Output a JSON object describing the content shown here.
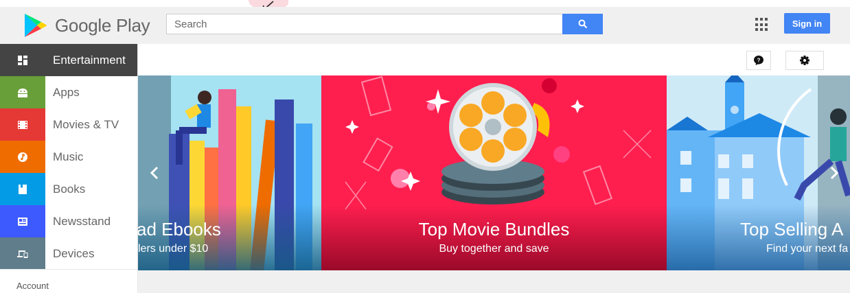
{
  "brand": {
    "name": "Google Play"
  },
  "search": {
    "placeholder": "Search"
  },
  "header": {
    "signin_label": "Sign in"
  },
  "sidebar": {
    "items": [
      {
        "label": "Entertainment",
        "color": "#444444",
        "icon": "entertainment-icon"
      },
      {
        "label": "Apps",
        "color": "#689f38",
        "icon": "android-icon"
      },
      {
        "label": "Movies & TV",
        "color": "#e53935",
        "icon": "film-icon"
      },
      {
        "label": "Music",
        "color": "#ef6c00",
        "icon": "music-note-icon"
      },
      {
        "label": "Books",
        "color": "#039be5",
        "icon": "book-icon"
      },
      {
        "label": "Newsstand",
        "color": "#3d5afe",
        "icon": "newspaper-icon"
      },
      {
        "label": "Devices",
        "color": "#607d8b",
        "icon": "devices-icon"
      }
    ],
    "account_label": "Account"
  },
  "carousel": {
    "slides": [
      {
        "title": "ad Ebooks",
        "subtitle": "lers under $10",
        "bg": "#4fc3f7"
      },
      {
        "title": "Top Movie Bundles",
        "subtitle": "Buy together and save",
        "bg": "#ff1f4f"
      },
      {
        "title": "Top Selling A",
        "subtitle": "Find your next fa",
        "bg": "#4fb3e8"
      }
    ]
  }
}
